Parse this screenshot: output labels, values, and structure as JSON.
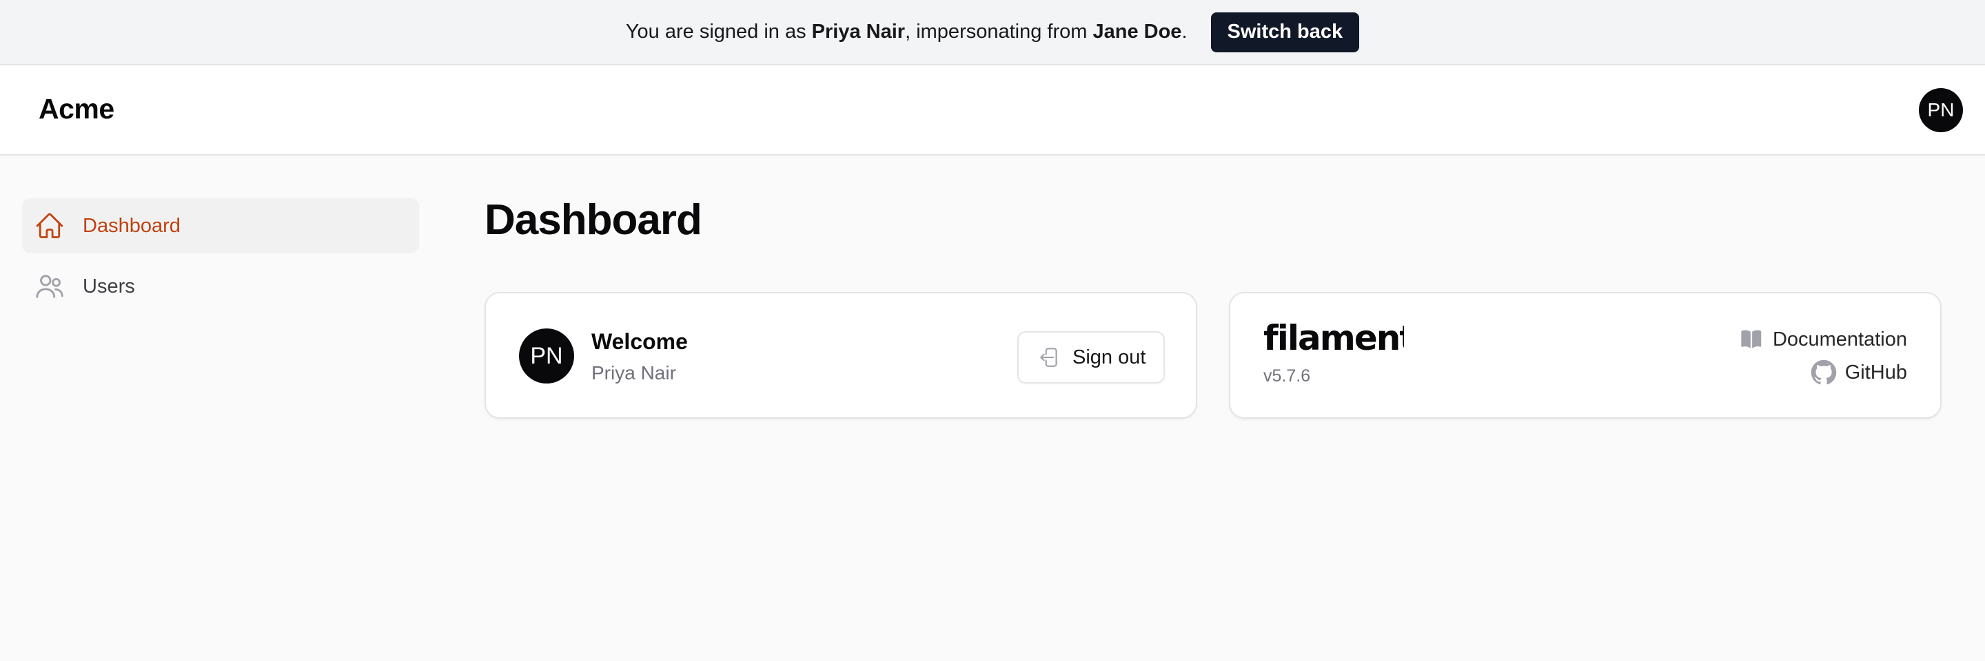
{
  "banner": {
    "prefix": "You are signed in as ",
    "user": "Priya Nair",
    "middle": ", impersonating from ",
    "impersonator": "Jane Doe",
    "suffix": ".",
    "switch_label": "Switch back"
  },
  "topbar": {
    "brand": "Acme",
    "avatar_initials": "PN"
  },
  "sidebar": {
    "items": [
      {
        "label": "Dashboard",
        "icon": "home-icon",
        "active": true
      },
      {
        "label": "Users",
        "icon": "users-icon",
        "active": false
      }
    ]
  },
  "main": {
    "title": "Dashboard",
    "account_widget": {
      "avatar_initials": "PN",
      "heading": "Welcome",
      "name": "Priya Nair",
      "signout_label": "Sign out"
    },
    "info_widget": {
      "logo_text": "filament",
      "version": "v5.7.6",
      "links": [
        {
          "label": "Documentation",
          "icon": "book-open-icon"
        },
        {
          "label": "GitHub",
          "icon": "github-icon"
        }
      ]
    }
  },
  "colors": {
    "accent": "#c2410c",
    "banner_bg": "#f3f4f6",
    "switch_button_bg": "#111827",
    "page_bg": "#fafafa",
    "avatar_bg": "#09090b"
  }
}
